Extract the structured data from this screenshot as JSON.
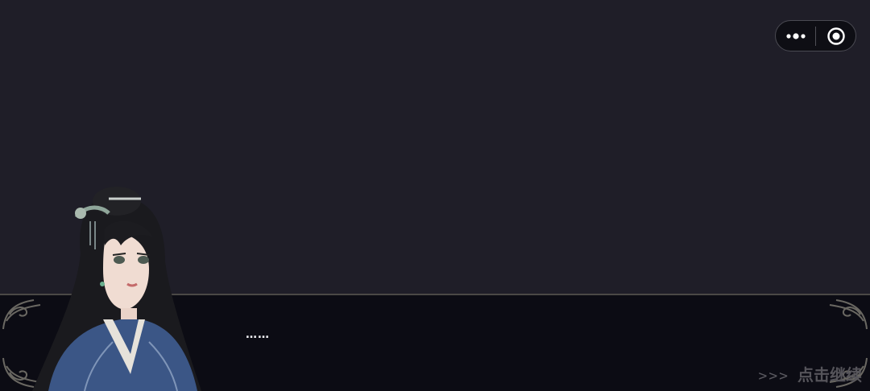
{
  "menu": {
    "more_icon": "more-dots-icon",
    "close_icon": "target-circle-icon"
  },
  "dialog": {
    "text": "……"
  },
  "continue": {
    "arrows": ">>>",
    "label": "点击继续"
  },
  "colors": {
    "scene_bg": "#1f1e28",
    "dialog_bg": "#0c0c14",
    "border": "#4b4946"
  },
  "character": {
    "icon": "lady-portrait"
  }
}
